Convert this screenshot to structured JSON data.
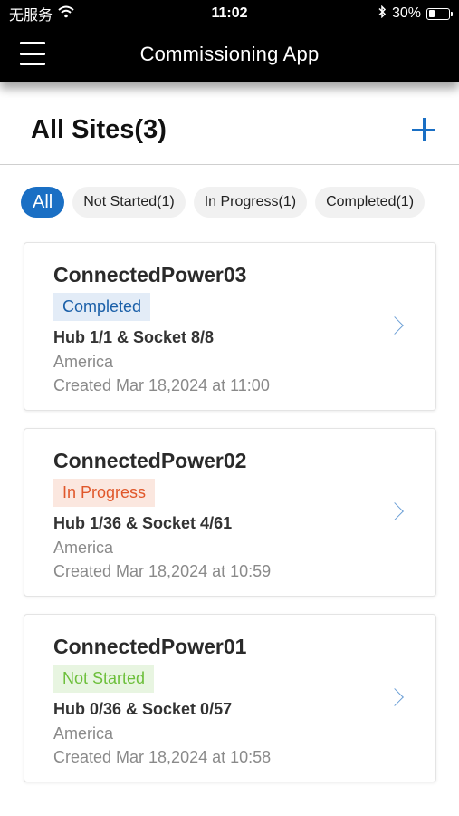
{
  "status_bar": {
    "carrier": "无服务",
    "time": "11:02",
    "battery_percent": "30%",
    "battery_level": 0.3,
    "icons": [
      "wifi-icon",
      "bluetooth-icon",
      "battery-icon"
    ]
  },
  "header": {
    "title": "Commissioning App",
    "menu_icon": "hamburger-menu-icon"
  },
  "page": {
    "title": "All Sites(3)",
    "add_icon": "plus-icon"
  },
  "filters": [
    {
      "label": "All",
      "active": true
    },
    {
      "label": "Not Started(1)",
      "active": false
    },
    {
      "label": "In Progress(1)",
      "active": false
    },
    {
      "label": "Completed(1)",
      "active": false
    }
  ],
  "sites": [
    {
      "name": "ConnectedPower03",
      "status": "Completed",
      "counts": "Hub 1/1 & Socket 8/8",
      "region": "America",
      "created": "Created Mar 18,2024 at 11:00"
    },
    {
      "name": "ConnectedPower02",
      "status": "In Progress",
      "counts": "Hub 1/36 & Socket 4/61",
      "region": "America",
      "created": "Created Mar 18,2024 at 10:59"
    },
    {
      "name": "ConnectedPower01",
      "status": "Not Started",
      "counts": "Hub 0/36 & Socket 0/57",
      "region": "America",
      "created": "Created Mar 18,2024 at 10:58"
    }
  ],
  "colors": {
    "accent": "#1a6fc4",
    "completed_text": "#1a5fa8",
    "completed_bg": "#e3ecf7",
    "inprogress_text": "#e0572a",
    "inprogress_bg": "#fbe7df",
    "notstarted_text": "#6cbf3a",
    "notstarted_bg": "#e8f5e1"
  }
}
